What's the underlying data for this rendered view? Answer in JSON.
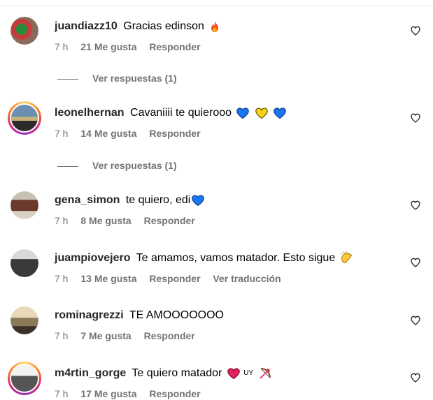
{
  "comments": [
    {
      "username": "juandiazz10",
      "text": "Gracias edinson",
      "emoji": "fire-icon",
      "time": "7 h",
      "likes": "21 Me gusta",
      "reply": "Responder",
      "view_replies": "Ver respuestas (1)"
    },
    {
      "username": "leonelhernan",
      "text": "Cavaniiii te quierooo",
      "emoji": "blue-yellow-blue-hearts-icon",
      "time": "7 h",
      "likes": "14 Me gusta",
      "reply": "Responder",
      "view_replies": "Ver respuestas (1)"
    },
    {
      "username": "gena_simon",
      "text": "te quiero, edi",
      "emoji": "blue-heart-icon",
      "time": "7 h",
      "likes": "8 Me gusta",
      "reply": "Responder"
    },
    {
      "username": "juampiovejero",
      "text": "Te amamos, vamos matador. Esto sigue",
      "emoji": "clapping-hands-icon",
      "time": "7 h",
      "likes": "13 Me gusta",
      "reply": "Responder",
      "translate": "Ver traducción"
    },
    {
      "username": "rominagrezzi",
      "text": "TE AMOOOOOOO",
      "time": "7 h",
      "likes": "7 Me gusta",
      "reply": "Responder"
    },
    {
      "username": "m4rtin_gorge",
      "text": "Te quiero matador",
      "inline_text": "UY",
      "emoji": "red-heart-and-bow-arrow-icon",
      "time": "7 h",
      "likes": "17 Me gusta",
      "reply": "Responder"
    }
  ],
  "colors": {
    "muted": "#737373",
    "blue_heart": "#1877f2",
    "yellow_heart": "#f7d21c",
    "red_heart": "#e0245e"
  }
}
